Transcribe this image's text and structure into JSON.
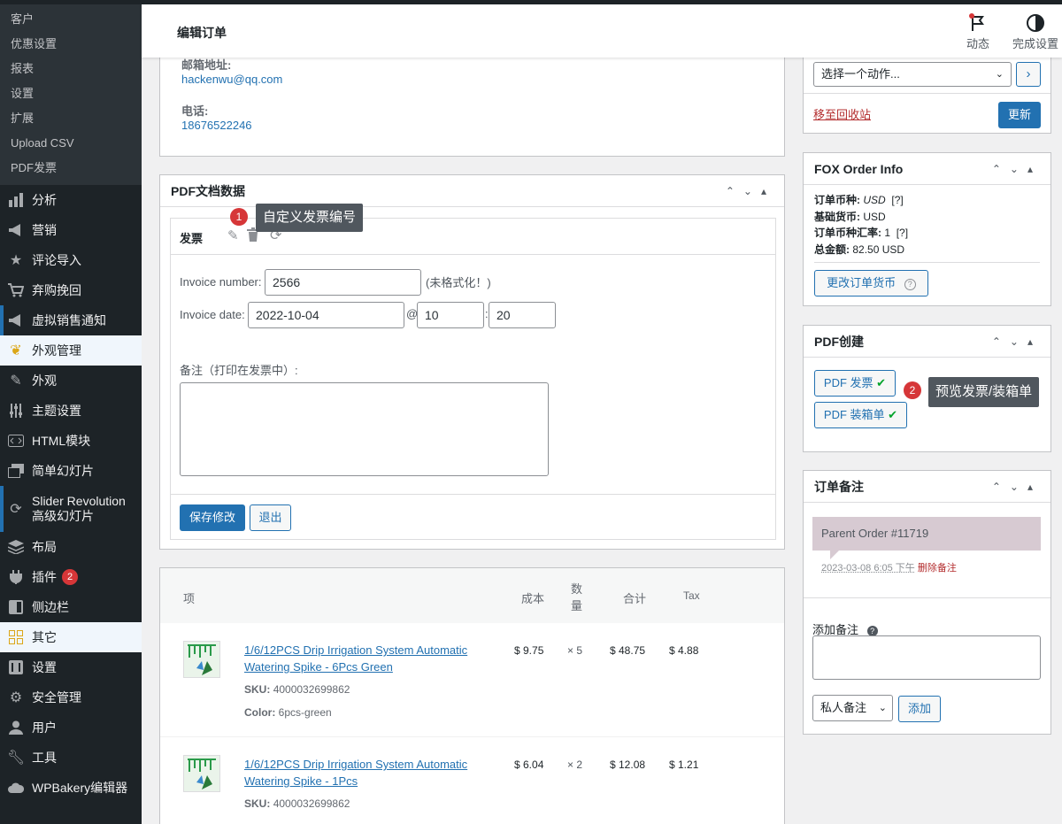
{
  "header": {
    "title": "编辑订单",
    "activity_label": "动态",
    "finish_label": "完成设置"
  },
  "sidebar": {
    "submenu": [
      "客户",
      "优惠设置",
      "报表",
      "设置",
      "扩展",
      "Upload CSV",
      "PDF发票"
    ],
    "items": [
      {
        "label": "分析",
        "icon": "bar-chart-icon"
      },
      {
        "label": "营销",
        "icon": "megaphone-icon"
      },
      {
        "label": "评论导入",
        "icon": "star-icon"
      },
      {
        "label": "弃购挽回",
        "icon": "cart-icon"
      },
      {
        "label": "虚拟销售通知",
        "icon": "megaphone-icon"
      },
      {
        "label": "外观管理",
        "icon": "palm-icon"
      },
      {
        "label": "外观",
        "icon": "brush-icon"
      },
      {
        "label": "主题设置",
        "icon": "sliders-icon"
      },
      {
        "label": "HTML模块",
        "icon": "code-icon"
      },
      {
        "label": "简单幻灯片",
        "icon": "slides-icon"
      },
      {
        "label1": "Slider Revolution",
        "label2": "高级幻灯片",
        "icon": "refresh-icon"
      },
      {
        "label": "布局",
        "icon": "layers-icon"
      },
      {
        "label": "插件",
        "icon": "plugin-icon",
        "badge": "2"
      },
      {
        "label": "侧边栏",
        "icon": "sidebar-icon"
      },
      {
        "label": "其它",
        "icon": "grid-icon"
      },
      {
        "label": "设置",
        "icon": "settings-icon"
      },
      {
        "label": "安全管理",
        "icon": "gear-icon"
      },
      {
        "label": "用户",
        "icon": "user-icon"
      },
      {
        "label": "工具",
        "icon": "wrench-icon"
      },
      {
        "label": "WPBakery编辑器",
        "icon": "cloud-icon"
      }
    ]
  },
  "address": {
    "email_label": "邮箱地址:",
    "email": "hackenwu@qq.com",
    "phone_label": "电话:",
    "phone": "18676522246"
  },
  "pdf_doc": {
    "title": "PDF文档数据",
    "invoice_title": "发票",
    "tooltip1": "自定义发票编号",
    "dot1": "1",
    "invoice_number_label": "Invoice number:",
    "invoice_number": "2566",
    "unformatted": "(未格式化！)",
    "invoice_date_label": "Invoice date:",
    "invoice_date": "2022-10-04",
    "at": "@",
    "hour": "10",
    "colon": ":",
    "minute": "20",
    "note_label": "备注（打印在发票中）:",
    "save_label": "保存修改",
    "exit_label": "退出"
  },
  "items": {
    "headers": {
      "item": "项",
      "cost": "成本",
      "qty": "数量",
      "total": "合计",
      "tax": "Tax"
    },
    "rows": [
      {
        "name": "1/6/12PCS Drip Irrigation System Automatic Watering Spike - 6Pcs Green",
        "sku_label": "SKU:",
        "sku": "4000032699862",
        "color_label": "Color:",
        "color": "6pcs-green",
        "cost": "$ 9.75",
        "qty": "× 5",
        "total": "$ 48.75",
        "tax": "$ 4.88"
      },
      {
        "name": "1/6/12PCS Drip Irrigation System Automatic Watering Spike - 1Pcs",
        "sku_label": "SKU:",
        "sku": "4000032699862",
        "cost": "$ 6.04",
        "qty": "× 2",
        "total": "$ 12.08",
        "tax": "$ 1.21"
      }
    ]
  },
  "actions": {
    "select": "选择一个动作...",
    "go": "›",
    "trash": "移至回收站",
    "update": "更新"
  },
  "fox": {
    "title": "FOX Order Info",
    "currency_label": "订单币种:",
    "currency": "USD",
    "q1": "[?]",
    "base_label": "基础货币:",
    "base": "USD",
    "rate_label": "订单币种汇率:",
    "rate": "1",
    "q2": "[?]",
    "total_label": "总金额:",
    "total": "82.50 USD",
    "change_btn": "更改订单货币"
  },
  "pdf_create": {
    "title": "PDF创建",
    "invoice_btn": "PDF 发票",
    "packing_btn": "PDF 装箱单",
    "tooltip2": "预览发票/装箱单",
    "dot2": "2"
  },
  "notes": {
    "title": "订单备注",
    "note_text": "Parent Order #11719",
    "note_time": "2023-03-08 6:05 下午",
    "delete_label": "删除备注",
    "add_label": "添加备注",
    "type_select": "私人备注",
    "add_btn": "添加"
  }
}
